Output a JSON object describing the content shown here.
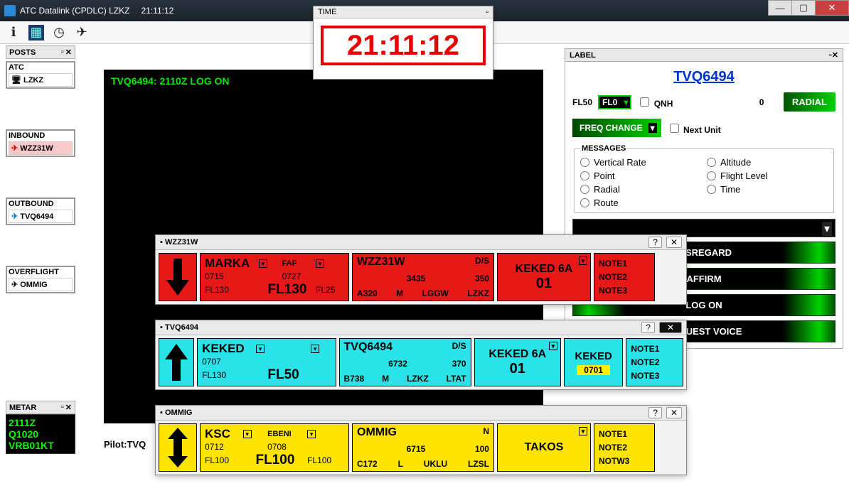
{
  "window": {
    "title": "ATC Datalink (CPDLC) LZKZ",
    "clock": "21:11:12"
  },
  "time_popup": {
    "title": "TIME",
    "value": "21:11:12"
  },
  "posts": {
    "title": "POSTS",
    "atc": {
      "title": "ATC",
      "items": [
        "LZKZ"
      ]
    },
    "inbound": {
      "title": "INBOUND",
      "items": [
        "WZZ31W"
      ]
    },
    "outbound": {
      "title": "OUTBOUND",
      "items": [
        "TVQ6494"
      ]
    },
    "overflight": {
      "title": "OVERFLIGHT",
      "items": [
        "OMMIG"
      ]
    }
  },
  "metar": {
    "title": "METAR",
    "lines": [
      "2111Z",
      "Q1020",
      "VRB01KT"
    ]
  },
  "radar": {
    "log": "TVQ6494: 2110Z LOG ON",
    "pilot_line": "Pilot:TVQ"
  },
  "label_panel": {
    "title": "LABEL",
    "callsign": "TVQ6494",
    "fl_static": "FL50",
    "fl_select": "FL0",
    "qnh_label": "QNH",
    "qnh_value": "0",
    "radial_btn": "RADIAL",
    "freq_select": "FREQ CHANGE",
    "next_unit": "Next Unit",
    "messages_title": "MESSAGES",
    "messages": [
      "Vertical Rate",
      "Altitude",
      "Point",
      "Flight Level",
      "Radial",
      "Time",
      "Route"
    ],
    "buttons": [
      "DISREGARD",
      "AFFIRM",
      "LOG ON",
      "REQUEST VOICE"
    ]
  },
  "strips": [
    {
      "id": "WZZ31W",
      "color": "red",
      "arrow": "down",
      "c1": {
        "fix": "MARKA",
        "eta": "0715",
        "cfl": "FL130",
        "assigned": "FL130",
        "faf": "FAF",
        "faf_eta": "0727",
        "faf_fl": "FL25"
      },
      "c2": {
        "call": "WZZ31W",
        "ds": "D/S",
        "sq": "3435",
        "wt": "350",
        "type": "A320",
        "cat": "M",
        "adep": "LGGW",
        "ades": "LZKZ"
      },
      "c3": {
        "proc": "KEKED 6A",
        "rwy": "01"
      },
      "c4": null,
      "notes": [
        "NOTE1",
        "NOTE2",
        "NOTE3"
      ]
    },
    {
      "id": "TVQ6494",
      "color": "cyan",
      "arrow": "up",
      "c1": {
        "fix": "KEKED",
        "eta": "0707",
        "cfl": "FL130",
        "assigned": "FL50",
        "faf": "",
        "faf_eta": "",
        "faf_fl": ""
      },
      "c2": {
        "call": "TVQ6494",
        "ds": "D/S",
        "sq": "6732",
        "wt": "370",
        "type": "B738",
        "cat": "M",
        "adep": "LZKZ",
        "ades": "LTAT"
      },
      "c3": {
        "proc": "KEKED 6A",
        "rwy": "01"
      },
      "c4": {
        "label": "KEKED",
        "time": "0701"
      },
      "notes": [
        "NOTE1",
        "NOTE2",
        "NOTE3"
      ]
    },
    {
      "id": "OMMIG",
      "color": "yellow",
      "arrow": "updown",
      "c1": {
        "fix": "KSC",
        "eta": "0712",
        "cfl": "FL100",
        "assigned": "FL100",
        "faf": "EBENI",
        "faf_eta": "0708",
        "faf_fl": "FL100"
      },
      "c2": {
        "call": "OMMIG",
        "ds": "N",
        "sq": "6715",
        "wt": "100",
        "type": "C172",
        "cat": "L",
        "adep": "UKLU",
        "ades": "LZSL"
      },
      "c3": {
        "proc": "TAKOS",
        "rwy": ""
      },
      "c4": null,
      "notes": [
        "NOTE1",
        "NOTE2",
        "NOTW3"
      ]
    }
  ]
}
